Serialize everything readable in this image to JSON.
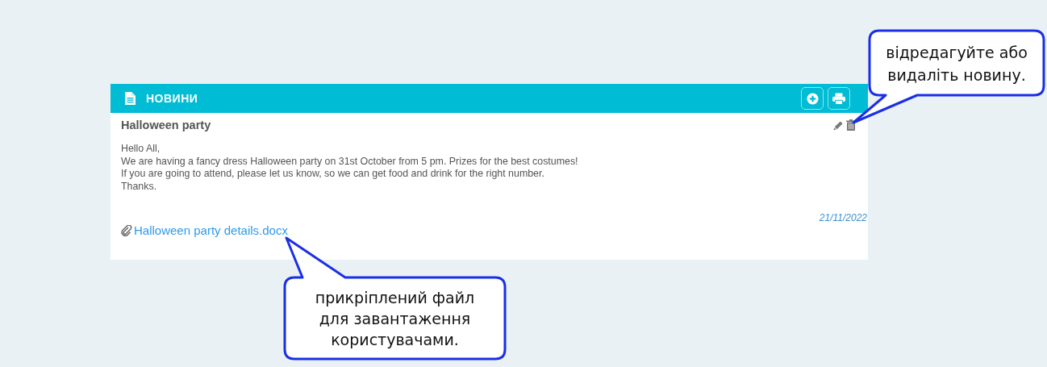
{
  "panel": {
    "title": "НОВИНИ"
  },
  "news": {
    "title": "Halloween party",
    "body": [
      "Hello All,",
      "We are having a fancy dress Halloween party on 31st October from 5 pm. Prizes for the best costumes!",
      "If you are going to attend, please let us know, so we can get food and drink for the right number.",
      "Thanks."
    ],
    "date": "21/11/2022",
    "attachment": "Halloween party details.docx"
  },
  "callouts": [
    {
      "lines": [
        "відредагуйте або",
        "видаліть новину."
      ]
    },
    {
      "lines": [
        "прикріплений файл",
        "для завантаження",
        "користувачами."
      ]
    }
  ]
}
